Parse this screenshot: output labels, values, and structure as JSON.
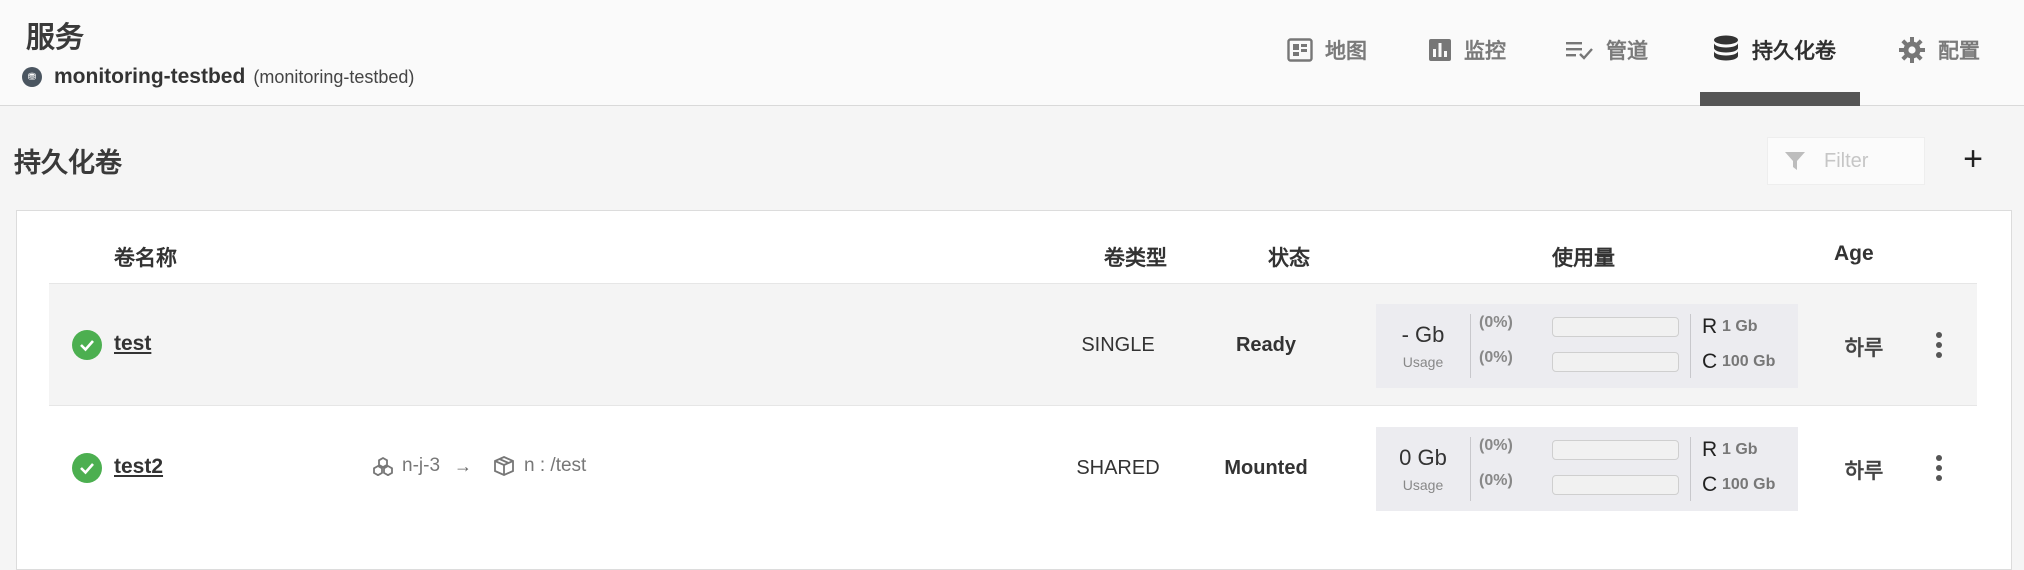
{
  "header": {
    "title": "服务",
    "project_icon_text": "⛃",
    "project_name": "monitoring-testbed",
    "project_sub": "(monitoring-testbed)"
  },
  "tabs": [
    {
      "label": "地图",
      "icon": "map-icon"
    },
    {
      "label": "监控",
      "icon": "bar-chart-icon"
    },
    {
      "label": "管道",
      "icon": "checklist-icon"
    },
    {
      "label": "持久化卷",
      "icon": "database-icon",
      "active": true
    },
    {
      "label": "配置",
      "icon": "gear-icon"
    }
  ],
  "section": {
    "title": "持久化卷",
    "filter_placeholder": "Filter",
    "add_label": "+"
  },
  "table": {
    "headers": {
      "name": "卷名称",
      "type": "卷类型",
      "state": "状态",
      "usage": "使用量",
      "age": "Age"
    },
    "rows": [
      {
        "name": "test",
        "status": "ok",
        "type": "SINGLE",
        "state": "Ready",
        "usage_value": "- Gb",
        "usage_label": "Usage",
        "r_pct": "(0%)",
        "c_pct": "(0%)",
        "r_letter": "R",
        "r_value": "1 Gb",
        "c_letter": "C",
        "c_value": "100 Gb",
        "age": "하루"
      },
      {
        "name": "test2",
        "status": "ok",
        "pod": "n-j-3",
        "mount": "n : /test",
        "type": "SHARED",
        "state": "Mounted",
        "usage_value": "0 Gb",
        "usage_label": "Usage",
        "r_pct": "(0%)",
        "c_pct": "(0%)",
        "r_letter": "R",
        "r_value": "1 Gb",
        "c_letter": "C",
        "c_value": "100 Gb",
        "age": "하루"
      }
    ]
  },
  "colors": {
    "status_ok": "#4caf50",
    "tab_indicator": "#555555"
  }
}
